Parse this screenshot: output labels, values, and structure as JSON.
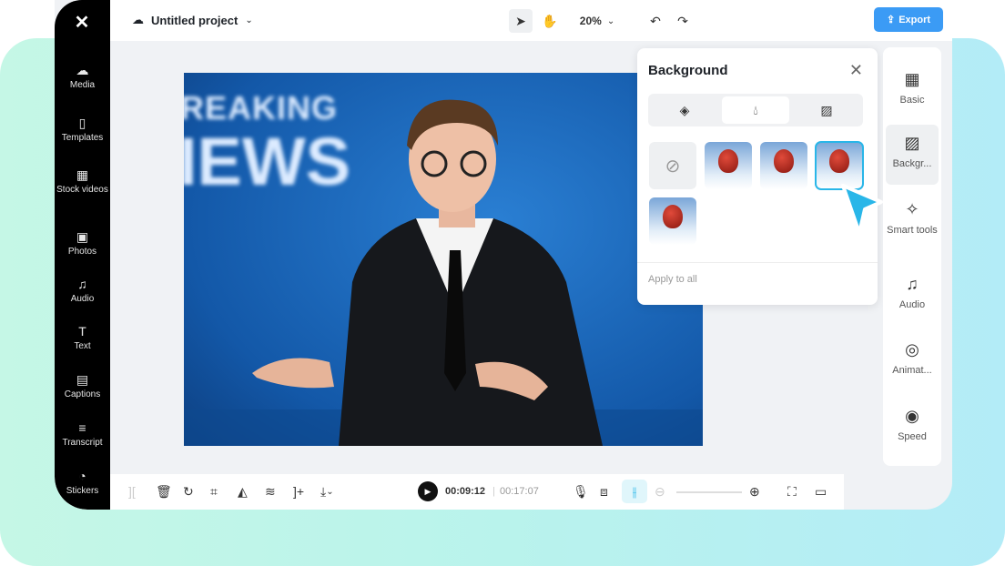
{
  "sidebar": {
    "items": [
      {
        "label": "Media",
        "icon": "cloud-upload-icon",
        "glyph": "☁"
      },
      {
        "label": "Templates",
        "icon": "templates-icon",
        "glyph": "▯"
      },
      {
        "label": "Stock videos",
        "icon": "film-icon",
        "glyph": "▦"
      },
      {
        "label": "Photos",
        "icon": "image-icon",
        "glyph": "▣"
      },
      {
        "label": "Audio",
        "icon": "music-icon",
        "glyph": "♫"
      },
      {
        "label": "Text",
        "icon": "text-icon",
        "glyph": "T"
      },
      {
        "label": "Captions",
        "icon": "captions-icon",
        "glyph": "▤"
      },
      {
        "label": "Transcript",
        "icon": "transcript-icon",
        "glyph": "≡"
      },
      {
        "label": "Stickers",
        "icon": "sticker-icon",
        "glyph": "◔"
      }
    ]
  },
  "header": {
    "project_title": "Untitled project",
    "zoom": "20%",
    "export_label": "Export"
  },
  "video": {
    "overlay_text_1": "REAKING",
    "overlay_text_2": "IEWS"
  },
  "background_panel": {
    "title": "Background",
    "tabs": [
      "color-fill",
      "blur",
      "pattern"
    ],
    "selected_tab": 1,
    "selected_thumb": 3,
    "apply_label": "Apply to all"
  },
  "right_panel": {
    "items": [
      {
        "label": "Basic",
        "glyph": "▦"
      },
      {
        "label": "Backgr...",
        "glyph": "▨"
      },
      {
        "label": "Smart tools",
        "glyph": "✧"
      },
      {
        "label": "Audio",
        "glyph": "♫"
      },
      {
        "label": "Animat...",
        "glyph": "◎"
      },
      {
        "label": "Speed",
        "glyph": "◉"
      }
    ],
    "active": 1
  },
  "timeline": {
    "current_time": "00:09:12",
    "total_time": "00:17:07"
  },
  "colors": {
    "accent": "#3b9bf5",
    "cursor": "#29b6e8",
    "active_bg": "#e0f6fb"
  }
}
